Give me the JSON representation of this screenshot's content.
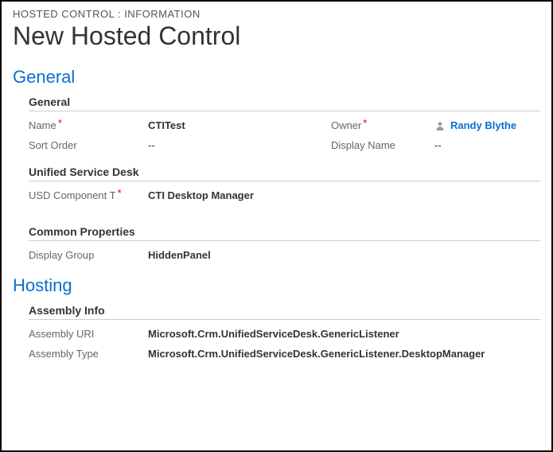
{
  "breadcrumb": "HOSTED CONTROL : INFORMATION",
  "page_title": "New Hosted Control",
  "sections": {
    "general": {
      "header": "General",
      "sub_general": {
        "title": "General",
        "name_label": "Name",
        "name_value": "CTITest",
        "owner_label": "Owner",
        "owner_value": "Randy Blythe",
        "sort_order_label": "Sort Order",
        "sort_order_value": "--",
        "display_name_label": "Display Name",
        "display_name_value": "--"
      },
      "sub_usd": {
        "title": "Unified Service Desk",
        "component_label": "USD Component T",
        "component_value": "CTI Desktop Manager"
      },
      "sub_common": {
        "title": "Common Properties",
        "display_group_label": "Display Group",
        "display_group_value": "HiddenPanel"
      }
    },
    "hosting": {
      "header": "Hosting",
      "sub_assembly": {
        "title": "Assembly Info",
        "uri_label": "Assembly URI",
        "uri_value": "Microsoft.Crm.UnifiedServiceDesk.GenericListener",
        "type_label": "Assembly Type",
        "type_value": "Microsoft.Crm.UnifiedServiceDesk.GenericListener.DesktopManager"
      }
    }
  }
}
